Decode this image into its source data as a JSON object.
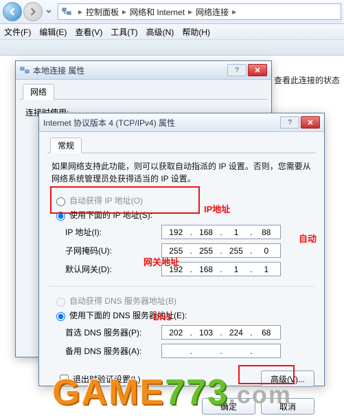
{
  "explorer": {
    "crumb1": "控制面板",
    "crumb2": "网络和 Internet",
    "crumb3": "网络连接"
  },
  "menu": {
    "file": "文件(F)",
    "edit": "编辑(E)",
    "view": "查看(V)",
    "tools": "工具(T)",
    "advanced": "高级(N)",
    "help": "帮助(H)"
  },
  "status_note": "查看此连接的状态",
  "dlg1": {
    "title": "本地连接 属性",
    "tab_net": "网络",
    "connect_using_label": "连接时使用:"
  },
  "dlg2": {
    "title": "Internet 协议版本 4 (TCP/IPv4) 属性",
    "tab_general": "常规",
    "desc": "如果网络支持此功能，则可以获取自动指派的 IP 设置。否则，您需要从网络系统管理员处获得适当的 IP 设置。",
    "radio_ip_auto": "自动获得 IP 地址(O)",
    "radio_ip_manual": "使用下面的 IP 地址(S):",
    "label_ip": "IP 地址(I):",
    "label_mask": "子网掩码(U):",
    "label_gw": "默认网关(D):",
    "radio_dns_auto": "自动获得 DNS 服务器地址(B)",
    "radio_dns_manual": "使用下面的 DNS 服务器地址(E):",
    "label_dns1": "首选 DNS 服务器(P):",
    "label_dns2": "备用 DNS 服务器(A):",
    "chk_validate": "退出时验证设置(L)",
    "btn_adv": "高级(V)...",
    "btn_ok": "确定",
    "btn_cancel": "取消",
    "ip": {
      "o1": "192",
      "o2": "168",
      "o3": "1",
      "o4": "88"
    },
    "mask": {
      "o1": "255",
      "o2": "255",
      "o3": "255",
      "o4": "0"
    },
    "gw": {
      "o1": "192",
      "o2": "168",
      "o3": "1",
      "o4": "1"
    },
    "dns1": {
      "o1": "202",
      "o2": "103",
      "o3": "224",
      "o4": "68"
    },
    "dns2": {
      "o1": "",
      "o2": "",
      "o3": "",
      "o4": ""
    }
  },
  "anno": {
    "ip": "IP地址",
    "auto": "自动",
    "gw": "网关地址",
    "dns": "DNS"
  },
  "watermark": {
    "p1": "GAME",
    "p2": "773",
    "p3": ".com"
  }
}
